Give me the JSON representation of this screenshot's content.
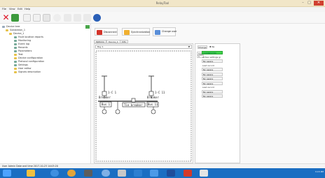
{
  "window": {
    "title": "RelayTool"
  },
  "menu": [
    {
      "label": "File"
    },
    {
      "label": "View"
    },
    {
      "label": "Edit"
    },
    {
      "label": "Help"
    }
  ],
  "actions": {
    "disconnect": "Disconnect",
    "synchronization": "Synchronization",
    "change_user": "Change user"
  },
  "tabs": [
    {
      "label": "Options"
    },
    {
      "label": "Device_1"
    },
    {
      "label": "Info"
    }
  ],
  "tree": {
    "root": "Device tree",
    "substation": "Substation_1",
    "device": "Device_1",
    "items": [
      "Fault location reports",
      "Monitoring",
      "Event log",
      "Records",
      "Parameters",
      "Test",
      "Device configuration",
      "Protocol configuration",
      "Settings",
      "User editor",
      "Signals description"
    ]
  },
  "diagram": {
    "select_value": "Bay 1",
    "breaker_left_code": "1-C 1",
    "breaker_left_label": "Breaker",
    "breaker_right_code": "1-C 11",
    "breaker_right_label": "Breaker",
    "bus_left": "Bus 1",
    "tie": "Tie breaker",
    "bus_right": "Bus 11"
  },
  "signals": {
    "change_label": "Change",
    "filter_label": "Re",
    "signal_header": "Signal",
    "value_label": "1"
  },
  "status": {
    "connected": "CONNECTED",
    "active_settings_label": "Active settings gr",
    "not_aware": "No aware",
    "last_record_label": "Last record",
    "last_record2_label": "Last record"
  },
  "statusbar": {
    "text": "User Admin   Date and time  2017-10-23 14:03:20"
  },
  "taskbar": {
    "clock": "3:15 PM"
  },
  "colors": {
    "accent": "#1b6ec2",
    "connected": "#3fd24a",
    "close": "#d04030"
  }
}
